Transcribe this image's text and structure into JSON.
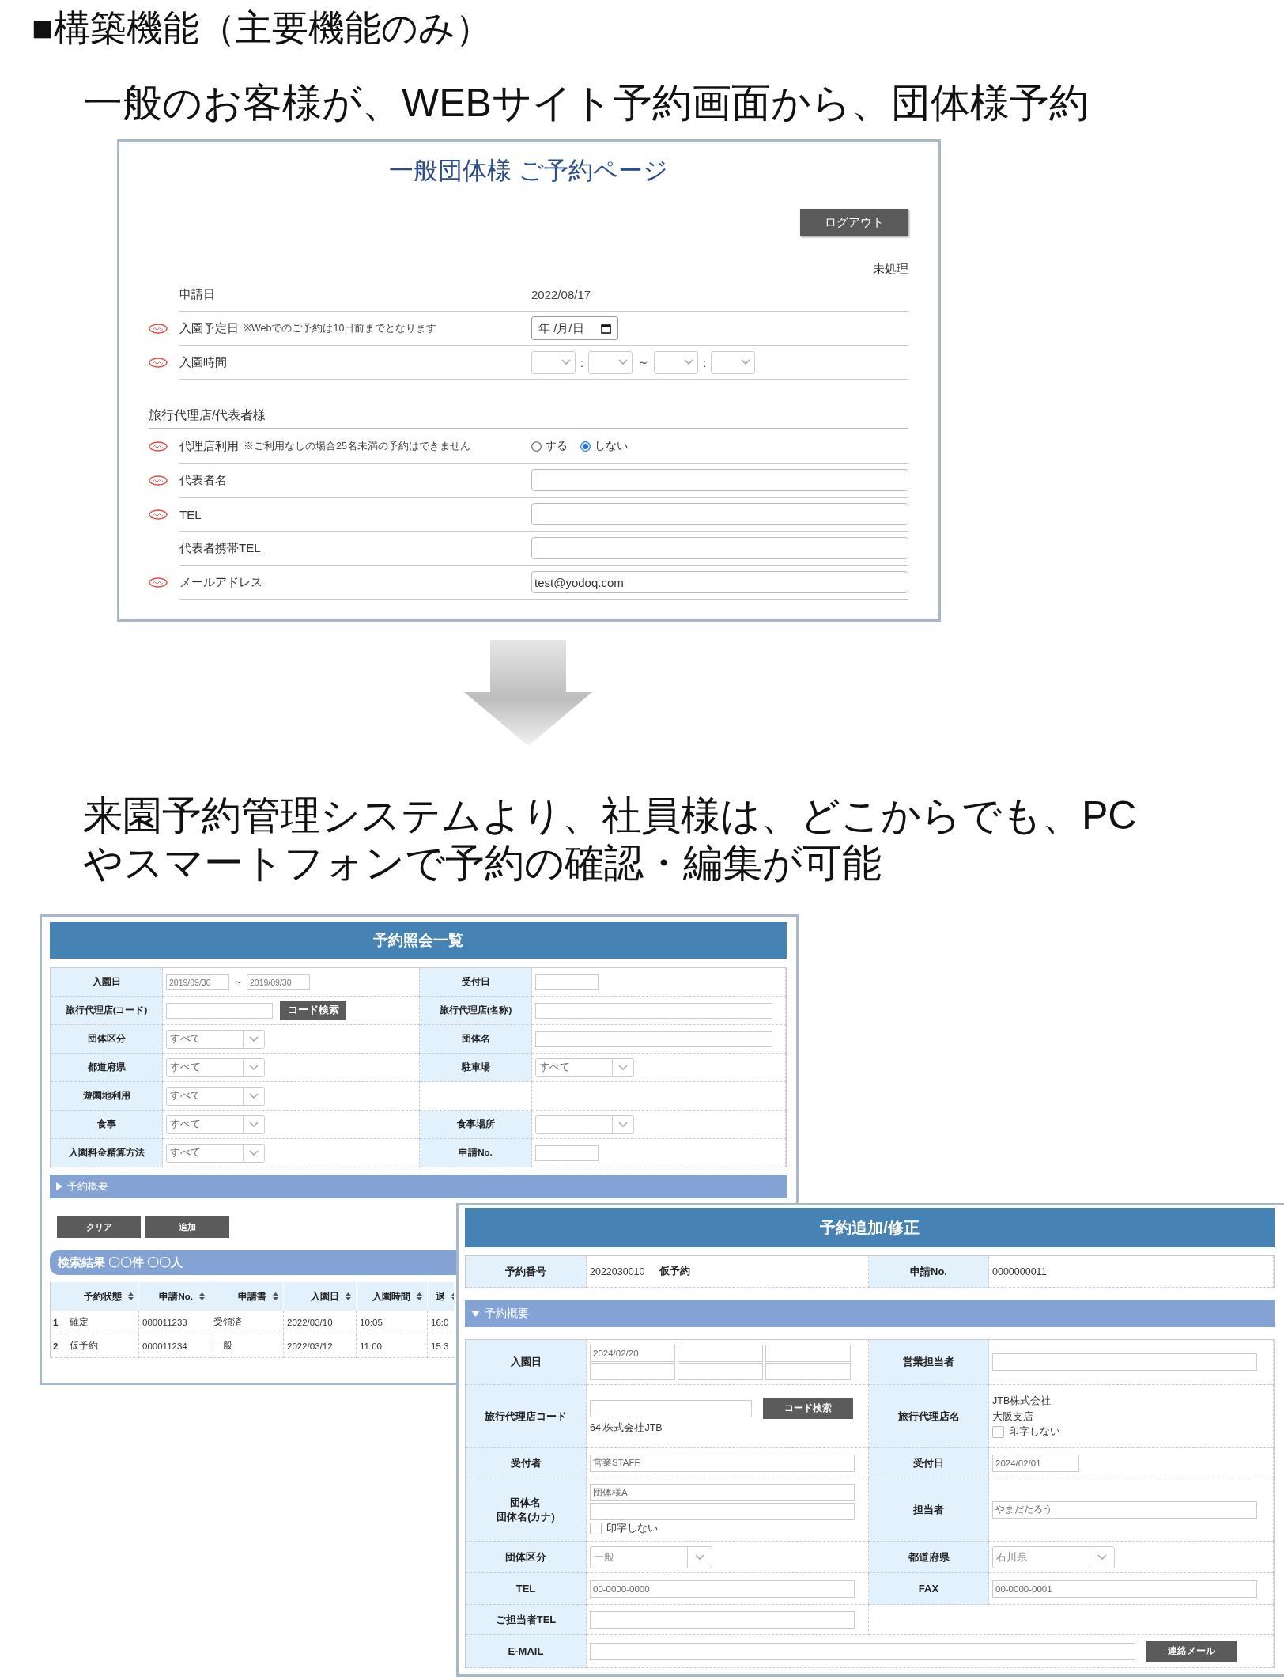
{
  "heading": "■構築機能（主要機能のみ）",
  "intro": "一般のお客様が、WEBサイト予約画面から、団体様予約",
  "web_form": {
    "title": "一般団体様 ご予約ページ",
    "logout_button": "ログアウト",
    "status": "未処理",
    "rows": [
      {
        "label": "申請日",
        "required": false,
        "kind": "text",
        "value": "2022/08/17"
      },
      {
        "label": "入園予定日",
        "note": "※Webでのご予約は10日前までとなります",
        "required": true,
        "kind": "date",
        "value": "年 /月/日"
      },
      {
        "label": "入園時間",
        "required": true,
        "kind": "time",
        "separators": [
          ":",
          "～",
          ":"
        ]
      }
    ],
    "section_title": "旅行代理店/代表者様",
    "section_rows": [
      {
        "label": "代理店利用",
        "note": "※ご利用なしの場合25名未満の予約はできません",
        "required": true,
        "kind": "radio",
        "options": [
          {
            "label": "する",
            "selected": false
          },
          {
            "label": "しない",
            "selected": true
          }
        ]
      },
      {
        "label": "代表者名",
        "required": true,
        "kind": "input"
      },
      {
        "label": "TEL",
        "required": true,
        "kind": "input"
      },
      {
        "label": "代表者携帯TEL",
        "required": false,
        "kind": "input"
      },
      {
        "label": "メールアドレス",
        "required": true,
        "kind": "input",
        "value": "test@yodoq.com"
      }
    ]
  },
  "description": {
    "lines": [
      "来園予約管理システムより、社員様は、どこからでも、PC",
      "やスマートフォンで予約の確認・編集が可能"
    ]
  },
  "list_screen": {
    "title": "予約照会一覧",
    "search_rows": [
      {
        "left": {
          "label": "入園日",
          "kind": "date_range",
          "values": [
            "2019/09/30",
            "2019/09/30"
          ],
          "separator": "～"
        },
        "right": {
          "label": "受付日",
          "kind": "short_input"
        }
      },
      {
        "left": {
          "label": "旅行代理店(コード)",
          "kind": "input_button",
          "button": "コード検索"
        },
        "right": {
          "label": "旅行代理店(名称)",
          "kind": "input"
        }
      },
      {
        "left": {
          "label": "団体区分",
          "kind": "select",
          "value": "すべて"
        },
        "right": {
          "label": "団体名",
          "kind": "input"
        }
      },
      {
        "left": {
          "label": "都道府県",
          "kind": "select",
          "value": "すべて"
        },
        "right": {
          "label": "駐車場",
          "kind": "select",
          "value": "すべて"
        }
      },
      {
        "left": {
          "label": "遊園地利用",
          "kind": "select",
          "value": "すべて"
        }
      },
      {
        "left": {
          "label": "食事",
          "kind": "select",
          "value": "すべて"
        },
        "right": {
          "label": "食事場所",
          "kind": "select"
        }
      },
      {
        "left": {
          "label": "入園料金精算方法",
          "kind": "select",
          "value": "すべて"
        },
        "right": {
          "label": "申請No.",
          "kind": "short_input"
        }
      }
    ],
    "summary_bar": {
      "label": "予約概要",
      "expanded": false
    },
    "buttons": [
      "クリア",
      "追加"
    ],
    "results_title": "検索結果 〇〇件 〇〇人",
    "results": {
      "columns": [
        "予約状態",
        "申請No.",
        "申請書",
        "入園日",
        "入園時間",
        "退"
      ],
      "rows": [
        {
          "index": "1",
          "cells": [
            "確定",
            "000011233",
            "受領済",
            "2022/03/10",
            "10:05",
            "16:0"
          ]
        },
        {
          "index": "2",
          "cells": [
            "仮予約",
            "000011234",
            "一般",
            "2022/03/12",
            "11:00",
            "15:3"
          ]
        }
      ]
    }
  },
  "edit_screen": {
    "title": "予約追加/修正",
    "header": [
      {
        "label": "予約番号",
        "value": "2022030010",
        "status": "仮予約"
      },
      {
        "label": "申請No.",
        "value": "0000000011"
      }
    ],
    "summary_bar": {
      "label": "予約概要",
      "expanded": true
    },
    "rows": [
      {
        "left": {
          "label": "入園日",
          "kind": "date_grid",
          "value": "2024/02/20"
        },
        "right": {
          "label": "営業担当者",
          "kind": "input"
        }
      },
      {
        "left": {
          "label": "旅行代理店コード",
          "kind": "code_search",
          "button": "コード検索",
          "note": "64:株式会社JTB"
        },
        "right": {
          "label": "旅行代理店名",
          "kind": "lines_check",
          "lines": [
            "JTB株式会社",
            "大阪支店"
          ],
          "checkbox": {
            "label": "印字しない",
            "checked": false
          }
        }
      },
      {
        "left": {
          "label": "受付者",
          "kind": "input",
          "value": "営業STAFF"
        },
        "right": {
          "label": "受付日",
          "kind": "short_input",
          "value": "2024/02/01"
        }
      },
      {
        "left": {
          "labels": [
            "団体名",
            "団体名(カナ)"
          ],
          "kind": "double_input",
          "value": "団体様A",
          "checkbox": {
            "label": "印字しない",
            "checked": false
          }
        },
        "right": {
          "label": "担当者",
          "kind": "input",
          "value": "やまだたろう"
        }
      },
      {
        "left": {
          "label": "団体区分",
          "kind": "select",
          "value": "一般"
        },
        "right": {
          "label": "都道府県",
          "kind": "select",
          "value": "石川県"
        }
      },
      {
        "left": {
          "label": "TEL",
          "kind": "input",
          "value": "00-0000-0000"
        },
        "right": {
          "label": "FAX",
          "kind": "input",
          "value": "00-0000-0001"
        }
      },
      {
        "left": {
          "label": "ご担当者TEL",
          "kind": "input"
        }
      },
      {
        "left": {
          "label": "E-MAIL",
          "kind": "wide_input_button",
          "button": "連絡メール"
        }
      }
    ]
  }
}
